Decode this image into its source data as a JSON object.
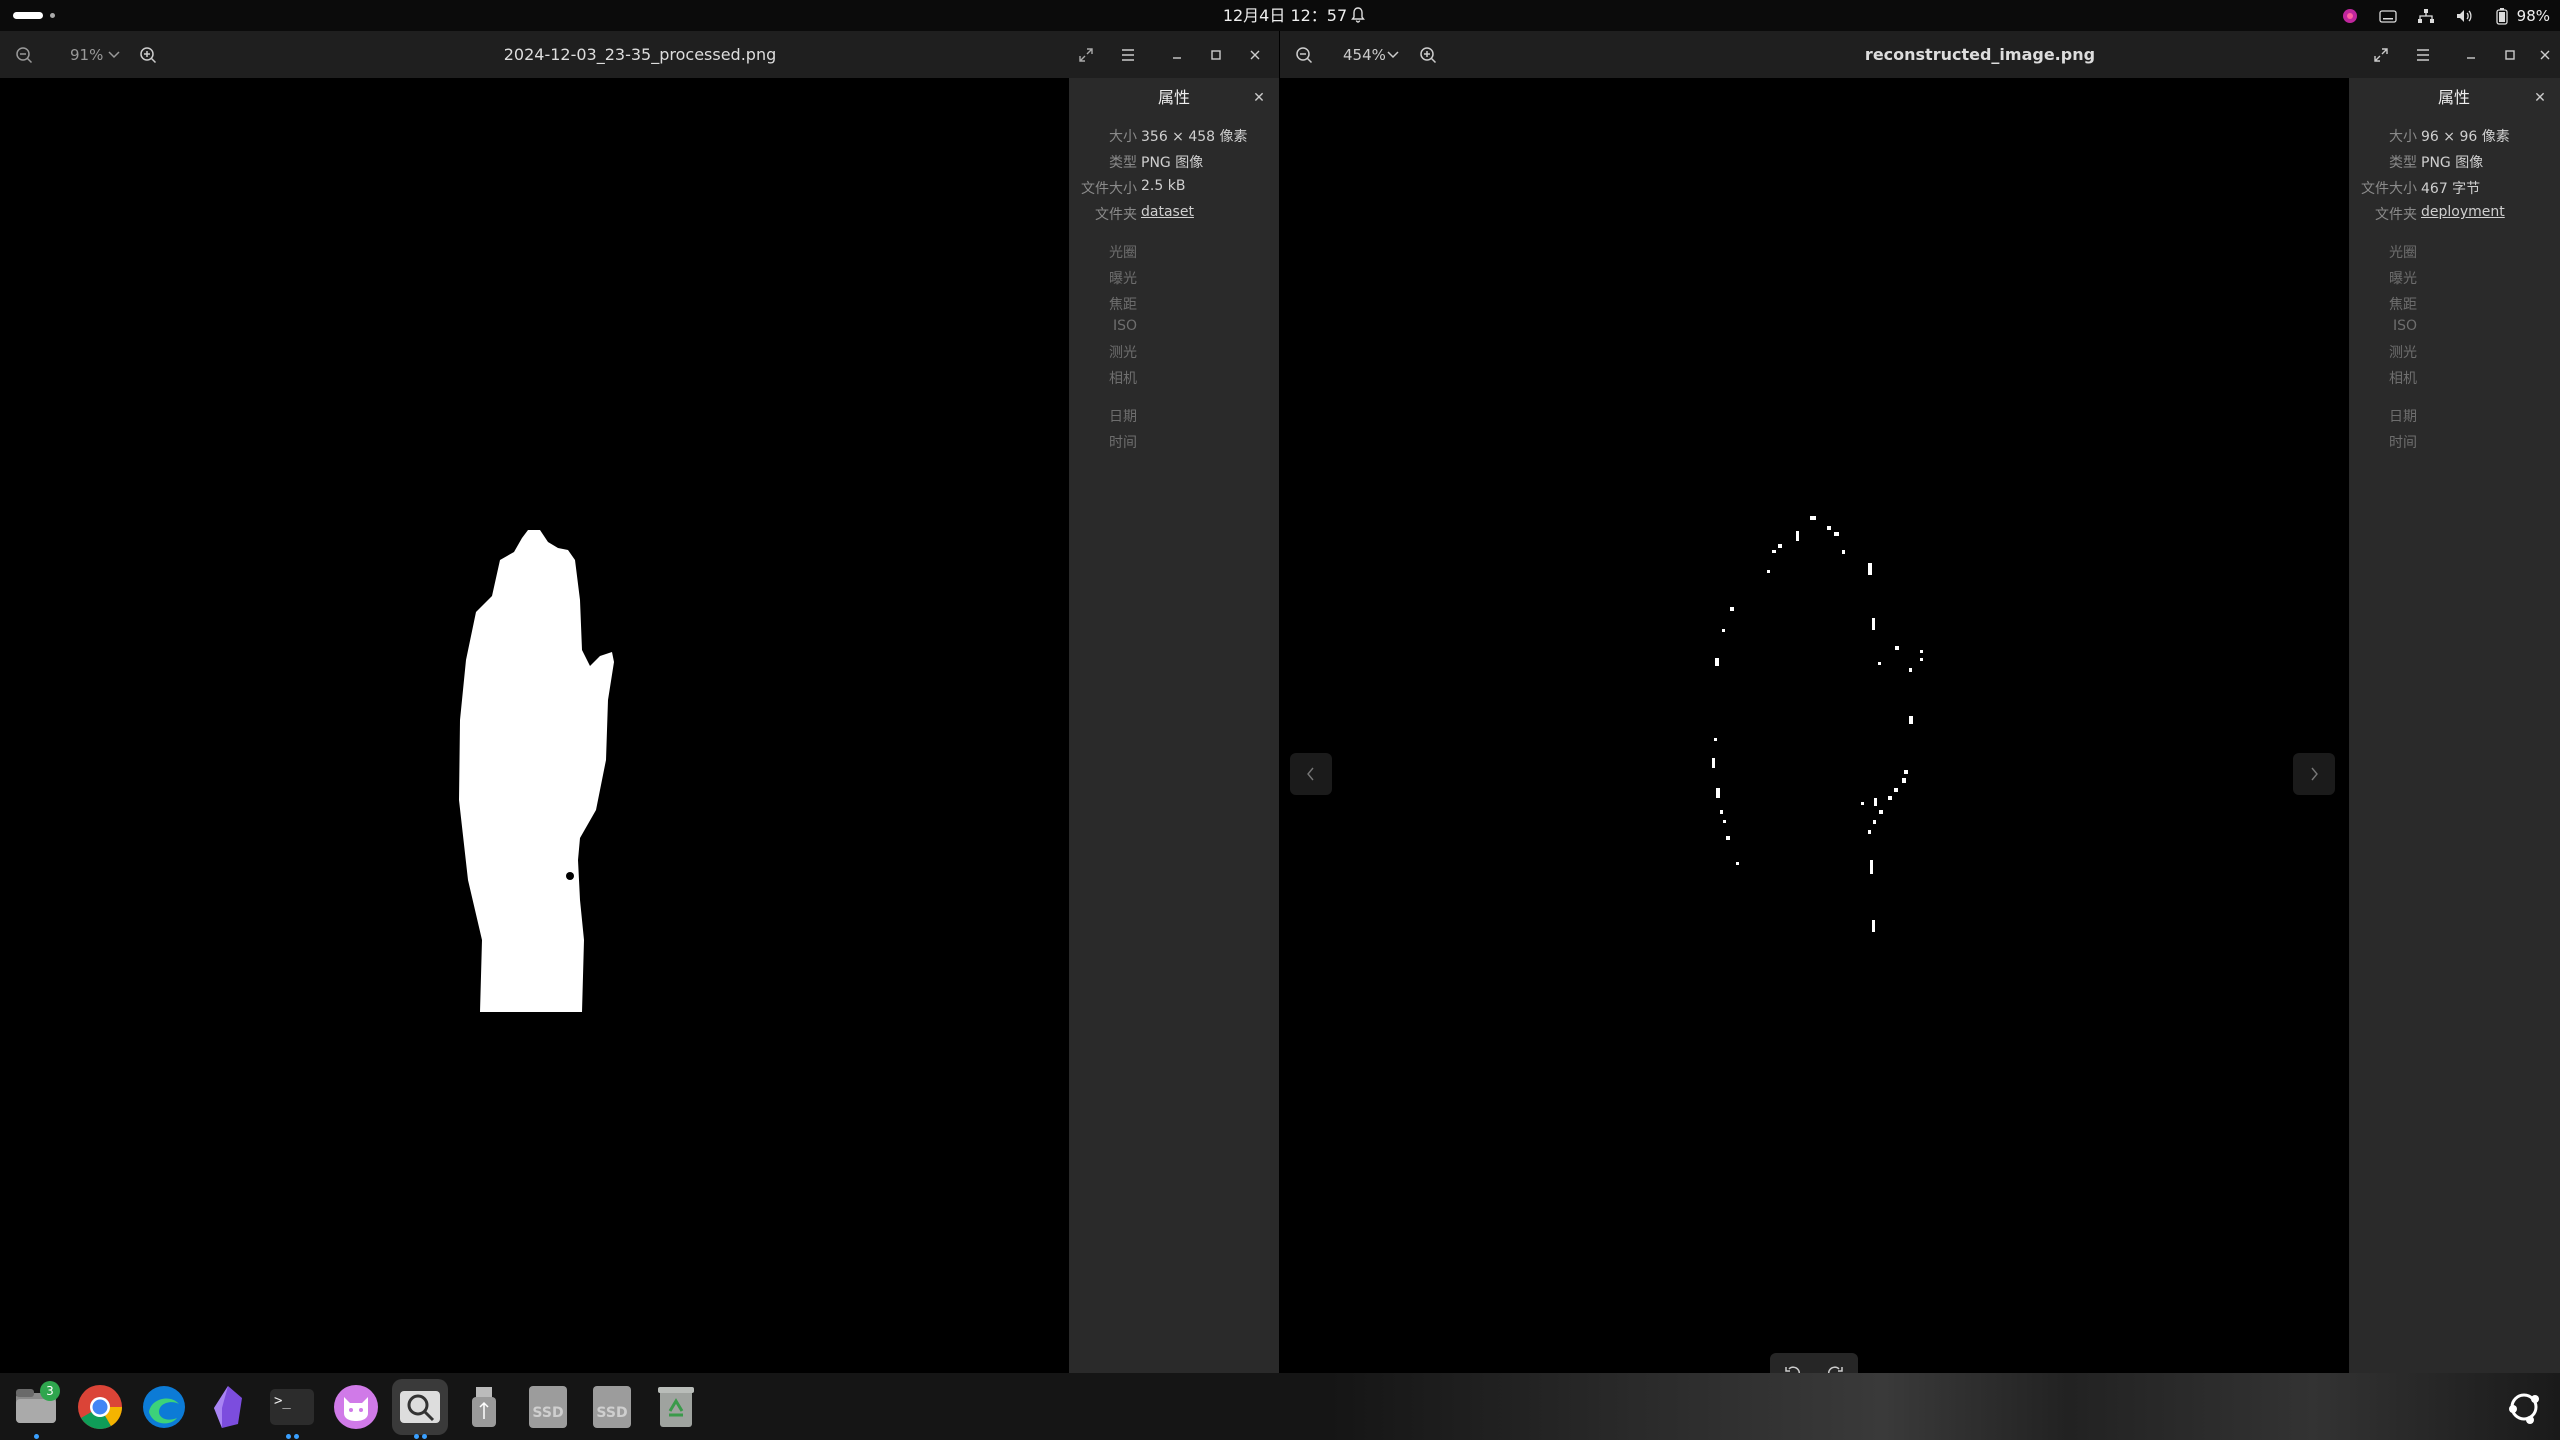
{
  "topbar": {
    "clock": "12月4日  12：57",
    "battery": "98%"
  },
  "left_window": {
    "zoom": "91%",
    "title": "2024-12-03_23-35_processed.png",
    "props": {
      "title": "属性",
      "rows": [
        {
          "key": "大小",
          "value": "356 × 458 像素"
        },
        {
          "key": "类型",
          "value": "PNG 图像"
        },
        {
          "key": "文件大小",
          "value": "2.5 kB"
        },
        {
          "key": "文件夹",
          "value": "dataset"
        }
      ],
      "exif": [
        "光圈",
        "曝光",
        "焦距",
        "ISO",
        "测光",
        "相机"
      ],
      "datetime": [
        "日期",
        "时间"
      ]
    }
  },
  "right_window": {
    "zoom": "454%",
    "title": "reconstructed_image.png",
    "props": {
      "title": "属性",
      "rows": [
        {
          "key": "大小",
          "value": "96 × 96 像素"
        },
        {
          "key": "类型",
          "value": "PNG 图像"
        },
        {
          "key": "文件大小",
          "value": "467 字节"
        },
        {
          "key": "文件夹",
          "value": "deployment"
        }
      ],
      "exif": [
        "光圈",
        "曝光",
        "焦距",
        "ISO",
        "测光",
        "相机"
      ],
      "datetime": [
        "日期",
        "时间"
      ]
    }
  },
  "dock": {
    "files_badge": "3",
    "terminal_glyph": ">_",
    "ssd1_label": "SSD",
    "ssd2_label": "SSD"
  },
  "colors": {
    "accent": "#3aa0ff",
    "link": "#5b9bf0",
    "panel": "#2a2a2a",
    "headerbar": "#1f1f1f"
  }
}
